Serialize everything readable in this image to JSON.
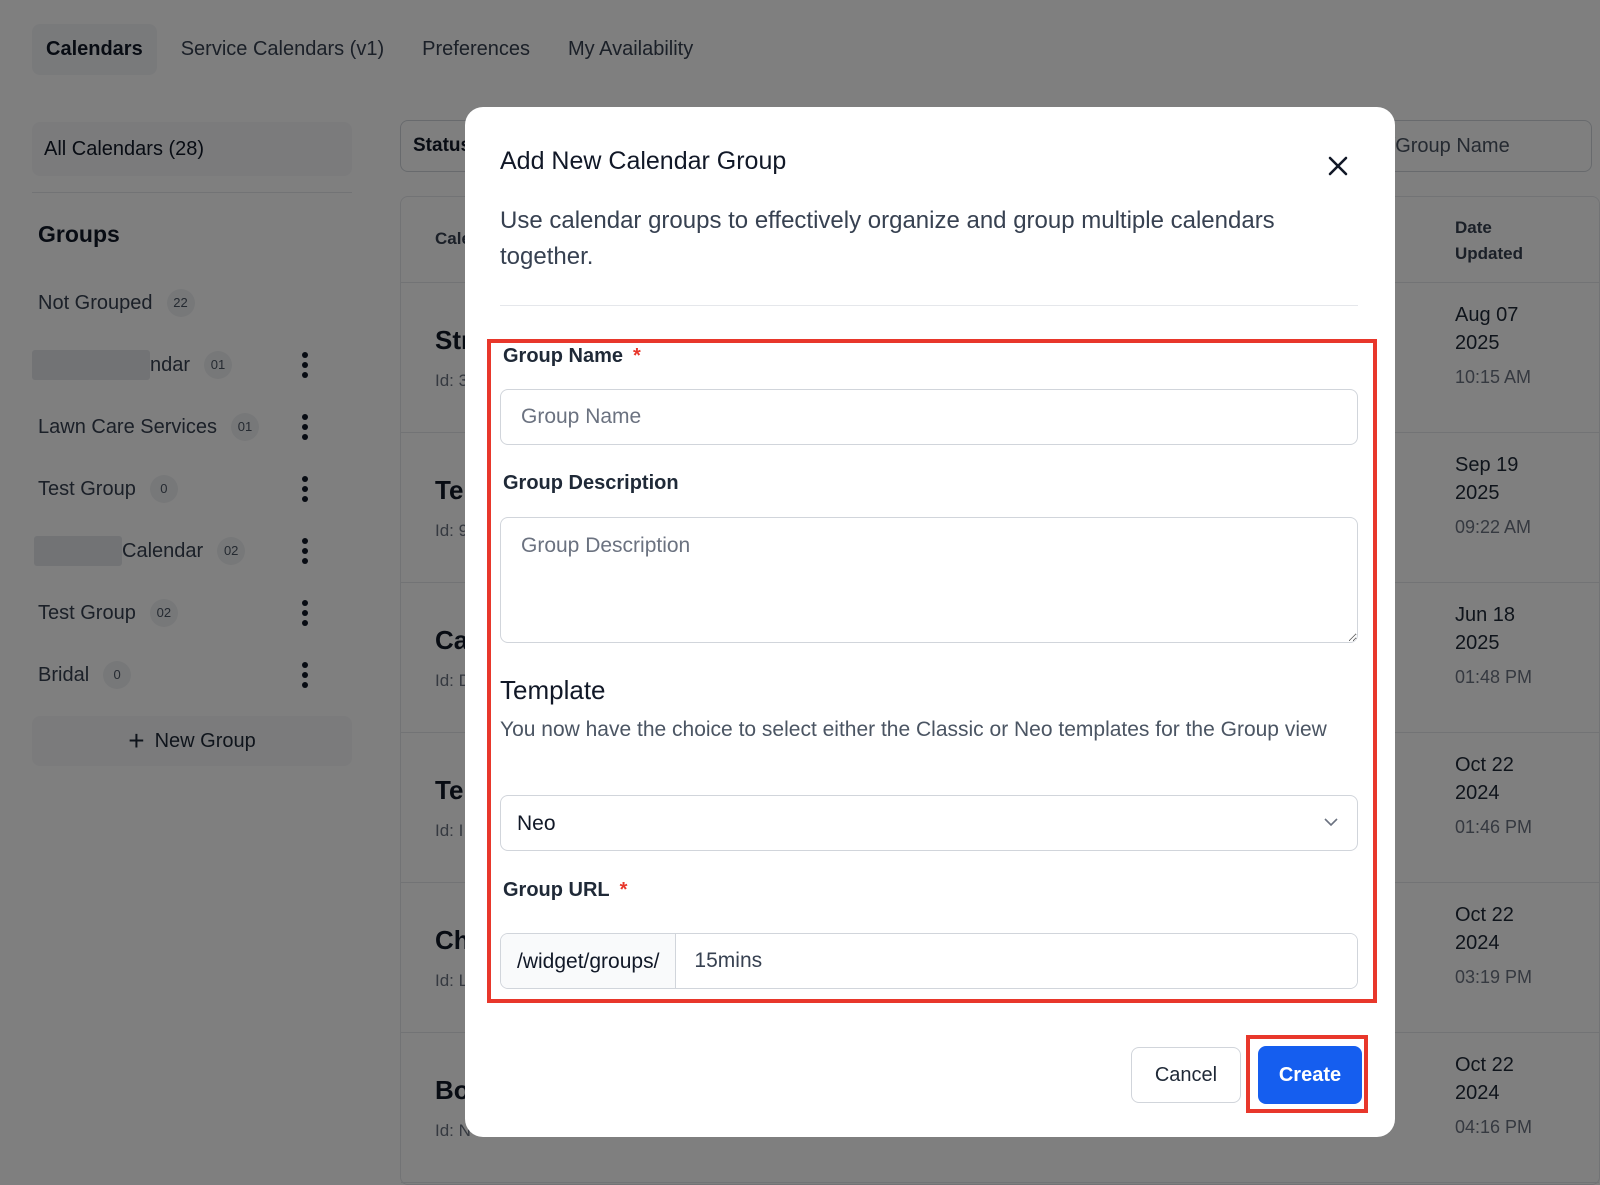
{
  "top_tabs": [
    "Calendars",
    "Service Calendars (v1)",
    "Preferences",
    "My Availability"
  ],
  "sidebar": {
    "all_calendars": "All Calendars (28)",
    "groups_heading": "Groups",
    "groups": [
      {
        "label": "Not Grouped",
        "count": "22"
      },
      {
        "label": "ndar",
        "count": "01"
      },
      {
        "label": "Lawn Care Services",
        "count": "01"
      },
      {
        "label": "Test Group",
        "count": "0"
      },
      {
        "label": "Calendar",
        "count": "02"
      },
      {
        "label": "Test Group",
        "count": "02"
      },
      {
        "label": "Bridal",
        "count": "0"
      }
    ],
    "new_group_label": "New Group"
  },
  "main": {
    "filter_label": "Status",
    "search_text": "r/Group Name",
    "col_name": "Cale",
    "col_date": "Date Updated",
    "rows": [
      {
        "name": "Str",
        "id": "Id: 3",
        "date": "Aug 07 2025",
        "time": "10:15 AM"
      },
      {
        "name": "Te",
        "id": "Id: 9",
        "date": "Sep 19 2025",
        "time": "09:22 AM"
      },
      {
        "name": "Ca",
        "id": "Id: D",
        "date": "Jun 18 2025",
        "time": "01:48 PM"
      },
      {
        "name": "Te",
        "id": "Id: I",
        "date": "Oct 22 2024",
        "time": "01:46 PM"
      },
      {
        "name": "Ch",
        "id": "Id: L",
        "date": "Oct 22 2024",
        "time": "03:19 PM"
      },
      {
        "name": "Bo",
        "id": "Id: N",
        "date": "Oct 22 2024",
        "time": "04:16 PM"
      }
    ]
  },
  "modal": {
    "title": "Add New Calendar Group",
    "description": "Use calendar groups to effectively organize and group multiple calendars together.",
    "group_name_label": "Group Name",
    "group_name_placeholder": "Group Name",
    "group_description_label": "Group Description",
    "group_description_placeholder": "Group Description",
    "template_heading": "Template",
    "template_description": "You now have the choice to select either the Classic or Neo templates for the Group view",
    "template_selected": "Neo",
    "group_url_label": "Group URL",
    "url_prefix": "/widget/groups/",
    "url_value": "15mins",
    "required_mark": "*",
    "cancel_label": "Cancel",
    "create_label": "Create"
  },
  "colors": {
    "primary": "#155eef",
    "highlight": "#e8372b",
    "overlay": "rgba(0,0,0,0.5)"
  },
  "icons": [
    "close-icon",
    "chevron-down-icon",
    "plus-icon",
    "kebab-menu-icon"
  ]
}
